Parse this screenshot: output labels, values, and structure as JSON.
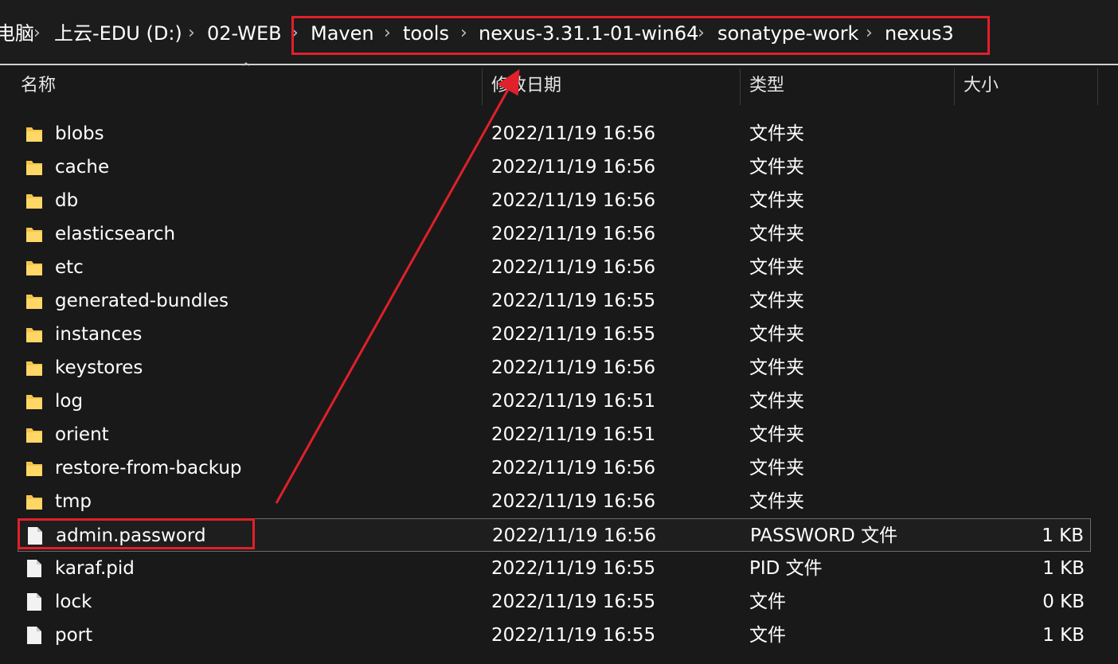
{
  "breadcrumb": {
    "items": [
      "电脑",
      "上云-EDU (D:)",
      "02-WEB",
      "Maven",
      "tools",
      "nexus-3.31.1-01-win64",
      "sonatype-work",
      "nexus3"
    ],
    "separator": "›"
  },
  "columns": {
    "name": "名称",
    "modified": "修改日期",
    "type": "类型",
    "size": "大小"
  },
  "files": [
    {
      "name": "blobs",
      "modified": "2022/11/19 16:56",
      "type": "文件夹",
      "size": "",
      "icon": "folder-icon"
    },
    {
      "name": "cache",
      "modified": "2022/11/19 16:56",
      "type": "文件夹",
      "size": "",
      "icon": "folder-icon"
    },
    {
      "name": "db",
      "modified": "2022/11/19 16:56",
      "type": "文件夹",
      "size": "",
      "icon": "folder-icon"
    },
    {
      "name": "elasticsearch",
      "modified": "2022/11/19 16:56",
      "type": "文件夹",
      "size": "",
      "icon": "folder-icon"
    },
    {
      "name": "etc",
      "modified": "2022/11/19 16:56",
      "type": "文件夹",
      "size": "",
      "icon": "folder-icon"
    },
    {
      "name": "generated-bundles",
      "modified": "2022/11/19 16:55",
      "type": "文件夹",
      "size": "",
      "icon": "folder-icon"
    },
    {
      "name": "instances",
      "modified": "2022/11/19 16:55",
      "type": "文件夹",
      "size": "",
      "icon": "folder-icon"
    },
    {
      "name": "keystores",
      "modified": "2022/11/19 16:56",
      "type": "文件夹",
      "size": "",
      "icon": "folder-icon"
    },
    {
      "name": "log",
      "modified": "2022/11/19 16:51",
      "type": "文件夹",
      "size": "",
      "icon": "folder-icon"
    },
    {
      "name": "orient",
      "modified": "2022/11/19 16:51",
      "type": "文件夹",
      "size": "",
      "icon": "folder-icon"
    },
    {
      "name": "restore-from-backup",
      "modified": "2022/11/19 16:56",
      "type": "文件夹",
      "size": "",
      "icon": "folder-icon"
    },
    {
      "name": "tmp",
      "modified": "2022/11/19 16:56",
      "type": "文件夹",
      "size": "",
      "icon": "folder-icon"
    },
    {
      "name": "admin.password",
      "modified": "2022/11/19 16:56",
      "type": "PASSWORD 文件",
      "size": "1 KB",
      "icon": "file-icon",
      "selected": true
    },
    {
      "name": "karaf.pid",
      "modified": "2022/11/19 16:55",
      "type": "PID 文件",
      "size": "1 KB",
      "icon": "file-icon"
    },
    {
      "name": "lock",
      "modified": "2022/11/19 16:55",
      "type": "文件",
      "size": "0 KB",
      "icon": "file-icon"
    },
    {
      "name": "port",
      "modified": "2022/11/19 16:55",
      "type": "文件",
      "size": "1 KB",
      "icon": "file-icon"
    }
  ],
  "colors": {
    "background": "#191919",
    "text": "#ffffff",
    "annotation_red": "#e0202a",
    "folder_yellow": "#f3c54b",
    "file_white": "#f2f2f2"
  }
}
